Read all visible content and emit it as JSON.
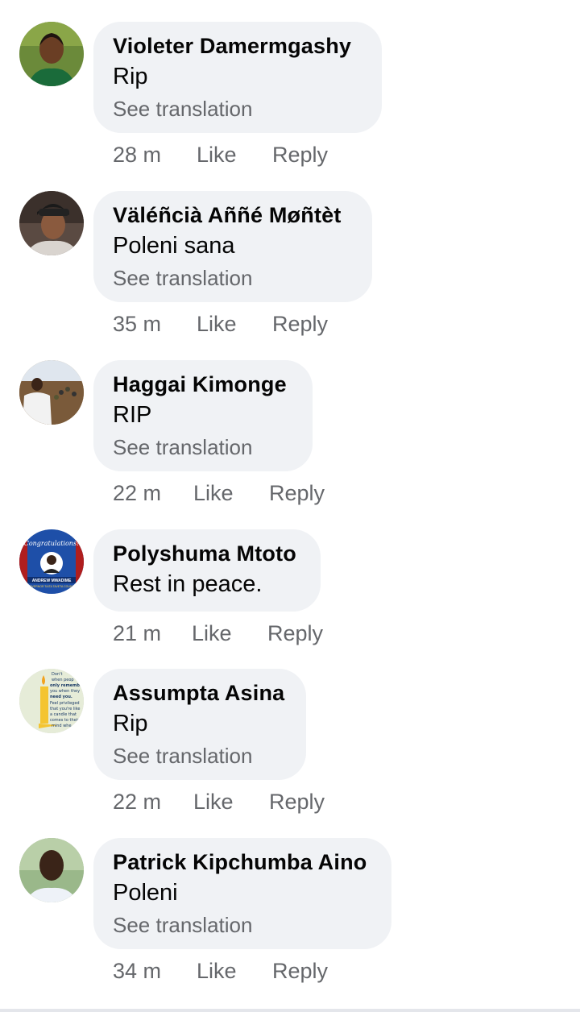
{
  "comments": [
    {
      "author": "Violeter Damermgashy",
      "text": "Rip",
      "translate": "See translation",
      "time": "28 m",
      "like": "Like",
      "reply": "Reply"
    },
    {
      "author": "Väléñcià Aññé Møñtèt",
      "text": "Poleni sana",
      "translate": "See translation",
      "time": "35 m",
      "like": "Like",
      "reply": "Reply"
    },
    {
      "author": "Haggai Kimonge",
      "text": "RIP",
      "translate": "See translation",
      "time": "22 m",
      "like": "Like",
      "reply": "Reply"
    },
    {
      "author": "Polyshuma Mtoto",
      "text": "Rest in peace.",
      "translate": "",
      "time": "21 m",
      "like": "Like",
      "reply": "Reply"
    },
    {
      "author": "Assumpta Asina",
      "text": "Rip",
      "translate": "See translation",
      "time": "22 m",
      "like": "Like",
      "reply": "Reply"
    },
    {
      "author": "Patrick Kipchumba Aino",
      "text": "Poleni",
      "translate": "See translation",
      "time": "34 m",
      "like": "Like",
      "reply": "Reply"
    }
  ],
  "avatar_texts": {
    "poster_heading": "Congratulations!",
    "poster_name": "ANDREW MWADIME",
    "poster_sub": "GOVERNOR TAITA TAVETA COUNTY",
    "quote": [
      "Don't",
      "when peop",
      "only remembe",
      "you when they",
      "need you.",
      "Feel privileged",
      "that you're like",
      "a candle that",
      "comes to their",
      "mind whe"
    ]
  },
  "colors": {
    "bubble": "#f0f2f5",
    "secondary_text": "#65676b",
    "primary_text": "#050505"
  }
}
